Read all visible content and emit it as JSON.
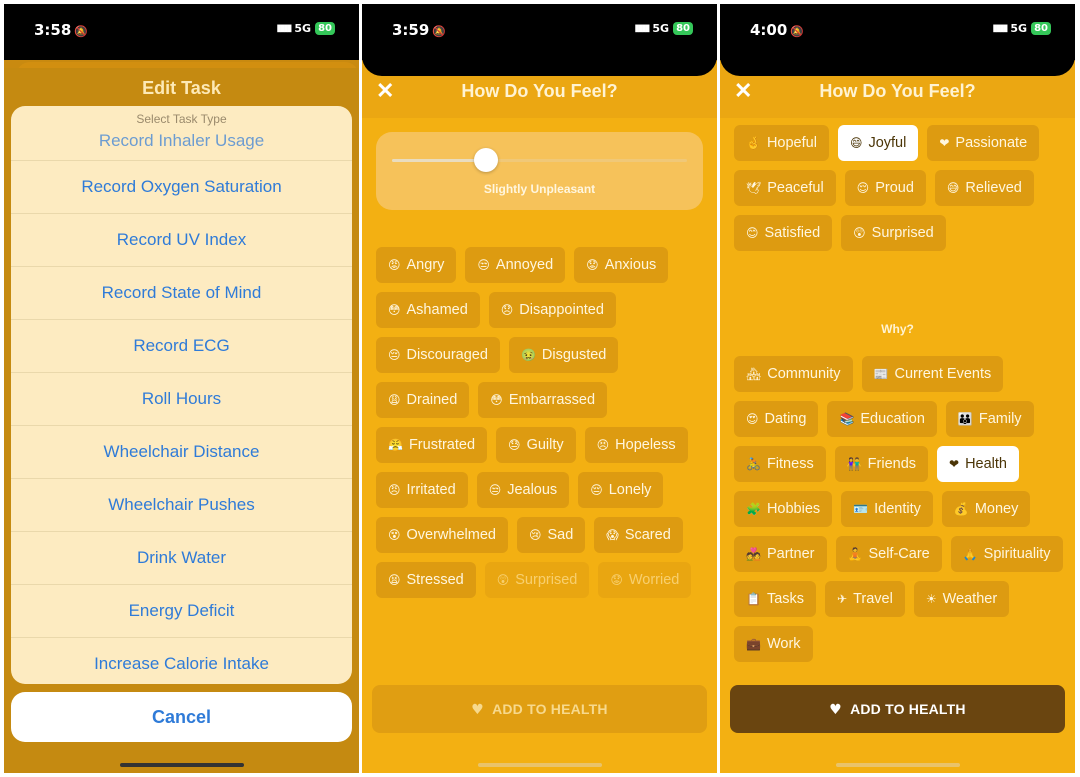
{
  "screens": [
    {
      "status": {
        "time": "3:58",
        "network": "5G",
        "battery": "80"
      },
      "header_title": "Edit Task",
      "list_title": "Select Task Type",
      "partial_item": "Record Inhaler Usage",
      "items": [
        "Record Oxygen Saturation",
        "Record UV Index",
        "Record State of Mind",
        "Record ECG",
        "Roll Hours",
        "Wheelchair Distance",
        "Wheelchair Pushes",
        "Drink Water",
        "Energy Deficit",
        "Increase Calorie Intake"
      ],
      "cancel_label": "Cancel"
    },
    {
      "status": {
        "time": "3:59",
        "network": "5G",
        "battery": "80"
      },
      "title": "How Do You Feel?",
      "slider": {
        "label": "Slightly Unpleasant",
        "value": 0.32
      },
      "feelings": [
        {
          "label": "Angry",
          "emoji": "😡"
        },
        {
          "label": "Annoyed",
          "emoji": "😒"
        },
        {
          "label": "Anxious",
          "emoji": "😟"
        },
        {
          "label": "Ashamed",
          "emoji": "😳"
        },
        {
          "label": "Disappointed",
          "emoji": "😞"
        },
        {
          "label": "Discouraged",
          "emoji": "😔"
        },
        {
          "label": "Disgusted",
          "emoji": "🤢"
        },
        {
          "label": "Drained",
          "emoji": "😩"
        },
        {
          "label": "Embarrassed",
          "emoji": "😳"
        },
        {
          "label": "Frustrated",
          "emoji": "😤"
        },
        {
          "label": "Guilty",
          "emoji": "😓"
        },
        {
          "label": "Hopeless",
          "emoji": "😣"
        },
        {
          "label": "Irritated",
          "emoji": "😠"
        },
        {
          "label": "Jealous",
          "emoji": "😒"
        },
        {
          "label": "Lonely",
          "emoji": "😔"
        },
        {
          "label": "Overwhelmed",
          "emoji": "😵"
        },
        {
          "label": "Sad",
          "emoji": "😢"
        },
        {
          "label": "Scared",
          "emoji": "😱"
        },
        {
          "label": "Stressed",
          "emoji": "😫"
        },
        {
          "label": "Surprised",
          "emoji": "😲",
          "faded": true
        },
        {
          "label": "Worried",
          "emoji": "😟",
          "faded": true
        }
      ],
      "add_label": "ADD TO HEALTH"
    },
    {
      "status": {
        "time": "4:00",
        "network": "5G",
        "battery": "80"
      },
      "title": "How Do You Feel?",
      "feelings": [
        {
          "label": "Hopeful",
          "emoji": "🤞"
        },
        {
          "label": "Joyful",
          "emoji": "😄",
          "selected": true
        },
        {
          "label": "Passionate",
          "emoji": "❤"
        },
        {
          "label": "Peaceful",
          "emoji": "🕊"
        },
        {
          "label": "Proud",
          "emoji": "😌"
        },
        {
          "label": "Relieved",
          "emoji": "😅"
        },
        {
          "label": "Satisfied",
          "emoji": "😊"
        },
        {
          "label": "Surprised",
          "emoji": "😲"
        }
      ],
      "why_label": "Why?",
      "reasons": [
        {
          "label": "Community",
          "emoji": "🏘"
        },
        {
          "label": "Current Events",
          "emoji": "📰"
        },
        {
          "label": "Dating",
          "emoji": "😍"
        },
        {
          "label": "Education",
          "emoji": "📚"
        },
        {
          "label": "Family",
          "emoji": "👪"
        },
        {
          "label": "Fitness",
          "emoji": "🚴"
        },
        {
          "label": "Friends",
          "emoji": "👫"
        },
        {
          "label": "Health",
          "emoji": "❤",
          "selected": true
        },
        {
          "label": "Hobbies",
          "emoji": "🧩"
        },
        {
          "label": "Identity",
          "emoji": "🪪"
        },
        {
          "label": "Money",
          "emoji": "💰"
        },
        {
          "label": "Partner",
          "emoji": "💑"
        },
        {
          "label": "Self-Care",
          "emoji": "🧘"
        },
        {
          "label": "Spirituality",
          "emoji": "🙏"
        },
        {
          "label": "Tasks",
          "emoji": "📋"
        },
        {
          "label": "Travel",
          "emoji": "✈"
        },
        {
          "label": "Weather",
          "emoji": "☀"
        },
        {
          "label": "Work",
          "emoji": "💼"
        }
      ],
      "add_label": "ADD TO HEALTH"
    }
  ]
}
